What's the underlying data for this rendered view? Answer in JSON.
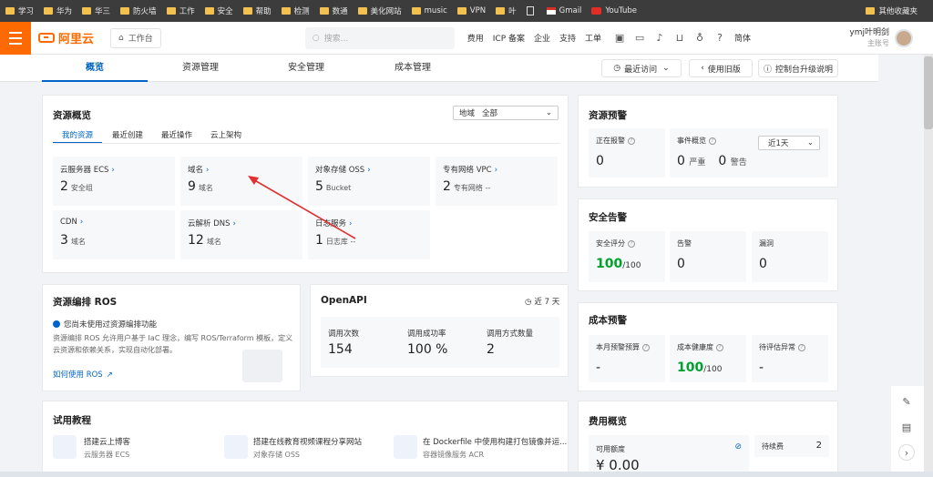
{
  "bookmarks": [
    "学习",
    "华为",
    "华三",
    "防火墙",
    "工作",
    "安全",
    "帮助",
    "检测",
    "数通",
    "美化网站",
    "music",
    "VPN",
    "叶",
    "Gmail",
    "YouTube"
  ],
  "bookmarks_right": "其他收藏夹",
  "topbar": {
    "logo": "阿里云",
    "workspace": "工作台",
    "search_placeholder": "搜索...",
    "nav": [
      "费用",
      "ICP 备案",
      "企业",
      "支持",
      "工单"
    ],
    "lang": "简体",
    "user_name": "ymj叶明剑",
    "user_role": "主账号"
  },
  "subnav": {
    "tabs": [
      "概览",
      "资源管理",
      "安全管理",
      "成本管理"
    ],
    "recent": "最近访问",
    "old_version": "使用旧版",
    "upgrade": "控制台升级说明"
  },
  "overview": {
    "title": "资源概览",
    "region_label": "地域",
    "region_value": "全部",
    "tabs": [
      "我的资源",
      "最近创建",
      "最近操作",
      "云上架构"
    ],
    "tiles": [
      {
        "name": "云服务器 ECS",
        "num": "2",
        "unit": "安全组"
      },
      {
        "name": "域名",
        "num": "9",
        "unit": "域名"
      },
      {
        "name": "对象存储 OSS",
        "num": "5",
        "unit": "Bucket"
      },
      {
        "name": "专有网络 VPC",
        "num": "2",
        "unit": "专有网络 --"
      },
      {
        "name": "CDN",
        "num": "3",
        "unit": "域名"
      },
      {
        "name": "云解析 DNS",
        "num": "12",
        "unit": "域名"
      },
      {
        "name": "日志服务",
        "num": "1",
        "unit": "日志库 --"
      }
    ]
  },
  "ros": {
    "title": "资源编排 ROS",
    "notice": "您尚未使用过资源编排功能",
    "desc1": "资源编排 ROS 允许用户基于 IaC 理念，编写 ROS/Terraform 模板，定义",
    "desc2": "云资源和依赖关系，实现自动化部署。",
    "link": "如何使用 ROS"
  },
  "openapi": {
    "title": "OpenAPI",
    "period": "近 7 天",
    "metrics": [
      {
        "label": "调用次数",
        "value": "154"
      },
      {
        "label": "调用成功率",
        "value": "100 %"
      },
      {
        "label": "调用方式数量",
        "value": "2"
      }
    ]
  },
  "tutorial": {
    "title": "试用教程",
    "items": [
      {
        "title": "搭建云上博客",
        "sub": "云服务器 ECS"
      },
      {
        "title": "搭建在线教育视频课程分享网站",
        "sub": "对象存储 OSS"
      },
      {
        "title": "在 Dockerfile 中使用构建打包镜像并运...",
        "sub": "容器镜像服务 ACR"
      }
    ]
  },
  "alert": {
    "title": "资源预警",
    "filter": "近1天",
    "items": [
      {
        "label": "正在报警",
        "value": "0"
      },
      {
        "label": "事件概览",
        "v1": "0",
        "l1": "严重",
        "v2": "0",
        "l2": "警告"
      }
    ]
  },
  "security": {
    "title": "安全告警",
    "items": [
      {
        "label": "安全评分",
        "value": "100",
        "sub": "/100"
      },
      {
        "label": "告警",
        "value": "0"
      },
      {
        "label": "漏洞",
        "value": "0"
      }
    ]
  },
  "cost": {
    "title": "成本预警",
    "items": [
      {
        "label": "本月预警预算",
        "value": "-"
      },
      {
        "label": "成本健康度",
        "value": "100",
        "sub": "/100"
      },
      {
        "label": "待评估异常",
        "value": "-"
      }
    ]
  },
  "fee": {
    "title": "费用概览",
    "available_label": "可用额度",
    "available_value": "¥ 0.00",
    "pending_label": "待续费",
    "pending_value": "2"
  },
  "colors": {
    "accent": "#ff6a00",
    "link": "#0064c8",
    "good": "#00a22d"
  }
}
